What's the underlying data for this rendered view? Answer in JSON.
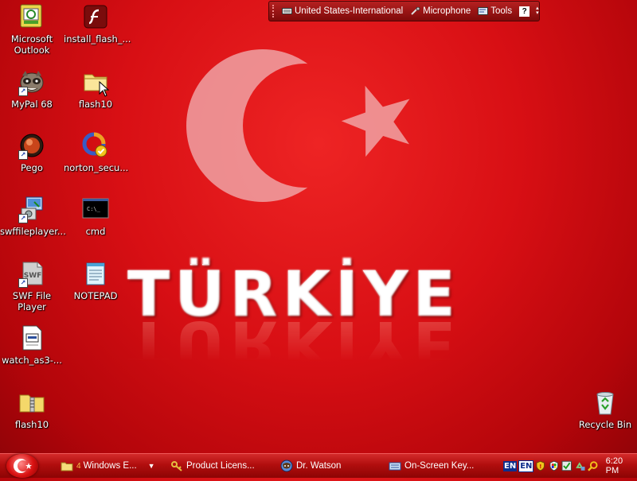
{
  "wallpaper": {
    "wordmark": "TÜRKİYE",
    "background_color": "#d80f14",
    "emblem_color": "#f4b3b0"
  },
  "desktop_icons": [
    {
      "id": "outlook",
      "label": "Microsoft Outlook",
      "icon": "outlook-icon"
    },
    {
      "id": "install-flash",
      "label": "install_flash_...",
      "icon": "flash-installer-icon"
    },
    {
      "id": "mypal",
      "label": "MyPal 68",
      "icon": "raccoon-browser-icon"
    },
    {
      "id": "flash10-folder",
      "label": "flash10",
      "icon": "folder-icon"
    },
    {
      "id": "pego",
      "label": "Pego",
      "icon": "pego-icon"
    },
    {
      "id": "norton",
      "label": "norton_secu...",
      "icon": "norton-icon"
    },
    {
      "id": "swffileplayer",
      "label": "swffileplayer...",
      "icon": "installer-icon"
    },
    {
      "id": "cmd",
      "label": "cmd",
      "icon": "console-icon"
    },
    {
      "id": "swf-player",
      "label": "SWF File Player",
      "icon": "swf-file-icon"
    },
    {
      "id": "notepad",
      "label": "NOTEPAD",
      "icon": "notepad-icon"
    },
    {
      "id": "watch-as3",
      "label": "watch_as3-...",
      "icon": "document-icon"
    },
    {
      "id": "flash10-zip",
      "label": "flash10",
      "icon": "zip-folder-icon"
    },
    {
      "id": "recycle-bin",
      "label": "Recycle Bin",
      "icon": "recycle-bin-icon"
    }
  ],
  "language_bar": {
    "keyboard_layout": "United States-International",
    "microphone": "Microphone",
    "tools": "Tools",
    "help": "?"
  },
  "taskbar": {
    "buttons": [
      {
        "label": "Windows E...",
        "count": "4",
        "icon": "folder-icon",
        "has_dropdown": true
      },
      {
        "label": "Product Licens...",
        "icon": "key-icon"
      },
      {
        "label": "Dr. Watson",
        "icon": "dr-watson-icon"
      },
      {
        "label": "On-Screen Key...",
        "icon": "keyboard-icon"
      }
    ],
    "tray": {
      "language_1": "EN",
      "language_2": "EN",
      "clock": "6:20 PM"
    }
  }
}
